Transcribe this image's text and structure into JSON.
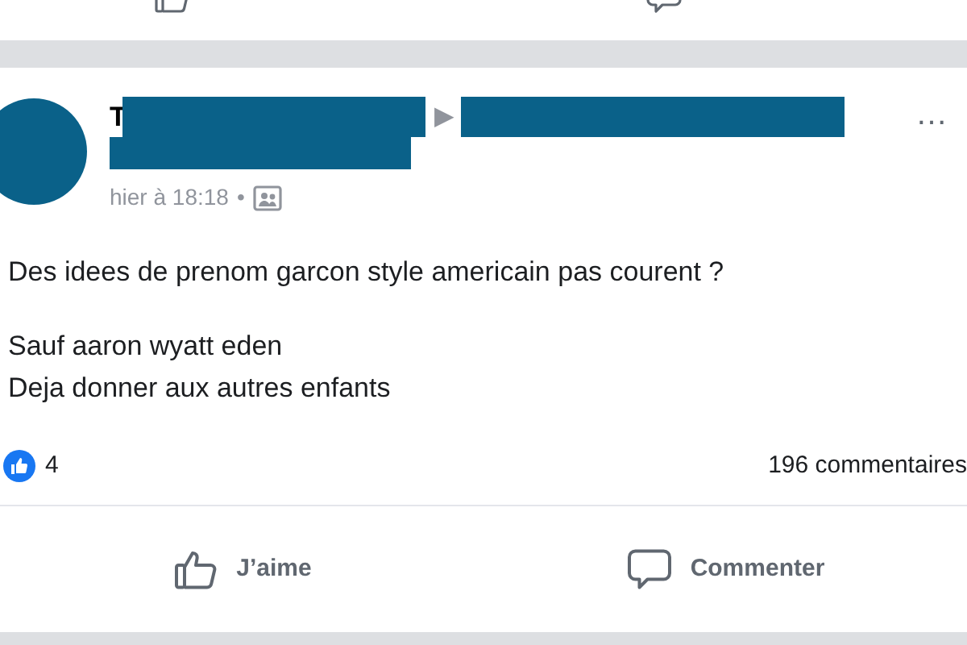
{
  "post": {
    "author_initial": "T",
    "audience_arrow": "▶",
    "more": "…",
    "time": "hier à 18:18",
    "separator": "•",
    "paragraphs": [
      [
        "Des idees de prenom garcon style americain pas courent ?"
      ],
      [
        "Sauf aaron wyatt eden",
        "Deja donner aux autres enfants"
      ]
    ],
    "reaction_count": "4",
    "comment_count": "196 commentaires",
    "actions": [
      {
        "kind": "like",
        "label": "J’aime"
      },
      {
        "kind": "comment",
        "label": "Commenter"
      }
    ]
  }
}
